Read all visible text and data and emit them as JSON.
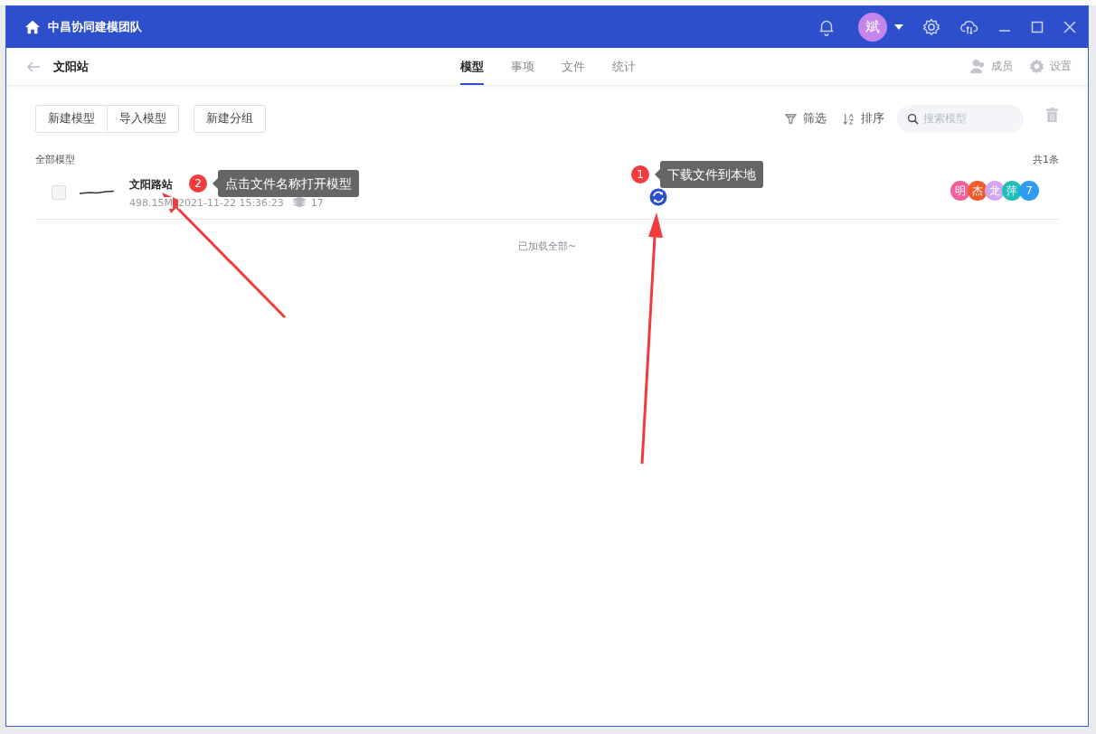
{
  "window": {
    "title": "中昌协同建模团队",
    "user_avatar": "斌"
  },
  "header": {
    "back_title": "文阳站",
    "tabs": [
      {
        "label": "模型",
        "selected": true
      },
      {
        "label": "事项",
        "selected": false
      },
      {
        "label": "文件",
        "selected": false
      },
      {
        "label": "统计",
        "selected": false
      }
    ],
    "actions": [
      {
        "kind": "members",
        "label": "成员"
      },
      {
        "kind": "settings",
        "label": "设置"
      }
    ]
  },
  "toolbar": {
    "buttons": [
      [
        "新建模型",
        "导入模型"
      ],
      [
        "新建分组"
      ]
    ],
    "filter": "筛选",
    "sort": "排序",
    "search": {
      "placeholder": "搜索模型"
    }
  },
  "list": {
    "group": "全部模型",
    "count": "共1条",
    "rows": [
      {
        "name": "文阳路站",
        "checked": false,
        "size": "498.15M",
        "date": "2021-11-22 15:36:23",
        "layers": "17",
        "members": [
          {
            "label": "明",
            "color": "#f0609a"
          },
          {
            "label": "杰",
            "color": "#f05a28"
          },
          {
            "label": "龙",
            "color": "#d4a6f0"
          },
          {
            "label": "萍",
            "color": "#1fbfb8"
          },
          {
            "label": "7",
            "color": "#2d9cf0"
          }
        ]
      }
    ],
    "footer": "已加载全部~"
  },
  "annotations": [
    {
      "number": "1",
      "text": "下载文件到本地"
    },
    {
      "number": "2",
      "text": "点击文件名称打开模型"
    }
  ]
}
